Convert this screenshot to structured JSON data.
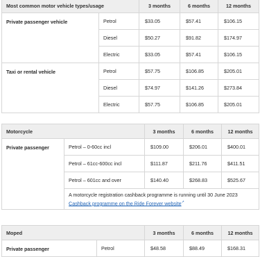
{
  "table1": {
    "headers": [
      "Most common motor vehicle types/usage",
      "3 months",
      "6 months",
      "12 months"
    ],
    "groups": [
      {
        "category": "Private passenger vehicle",
        "rows": [
          {
            "type": "Petrol",
            "m3": "$33.05",
            "m6": "$57.41",
            "m12": "$106.15"
          },
          {
            "type": "Diesel",
            "m3": "$50.27",
            "m6": "$91.82",
            "m12": "$174.97"
          },
          {
            "type": "Electric",
            "m3": "$33.05",
            "m6": "$57.41",
            "m12": "$106.15"
          }
        ]
      },
      {
        "category": "Taxi or rental vehicle",
        "rows": [
          {
            "type": "Petrol",
            "m3": "$57.75",
            "m6": "$106.85",
            "m12": "$205.01"
          },
          {
            "type": "Diesel",
            "m3": "$74.97",
            "m6": "$141.26",
            "m12": "$273.84"
          },
          {
            "type": "Electric",
            "m3": "$57.75",
            "m6": "$106.85",
            "m12": "$205.01"
          }
        ]
      }
    ]
  },
  "table2": {
    "headers": [
      "Motorcycle",
      "3 months",
      "6 months",
      "12 months"
    ],
    "category": "Private passenger",
    "rows": [
      {
        "type": "Petrol – 0-60cc incl",
        "m3": "$109.00",
        "m6": "$206.01",
        "m12": "$400.01"
      },
      {
        "type": "Petrol – 61cc-600cc incl",
        "m3": "$111.87",
        "m6": "$211.76",
        "m12": "$411.51"
      },
      {
        "type": "Petrol – 601cc and over",
        "m3": "$140.40",
        "m6": "$268.83",
        "m12": "$525.67"
      }
    ],
    "note": "A motorcycle registration cashback programme is running until 30 June 2023",
    "note_link": "Cashback programme on the Ride Forever website"
  },
  "table3": {
    "headers": [
      "Moped",
      "3 months",
      "6 months",
      "12 months"
    ],
    "category": "Private passenger",
    "rows": [
      {
        "type": "Petrol",
        "m3": "$48.58",
        "m6": "$88.49",
        "m12": "$168.31"
      }
    ]
  },
  "icons": {
    "external_link": "external-link-icon"
  },
  "colors": {
    "header_bg": "#eeeeee",
    "border": "#d6d6d6",
    "link": "#1a5fb4"
  }
}
